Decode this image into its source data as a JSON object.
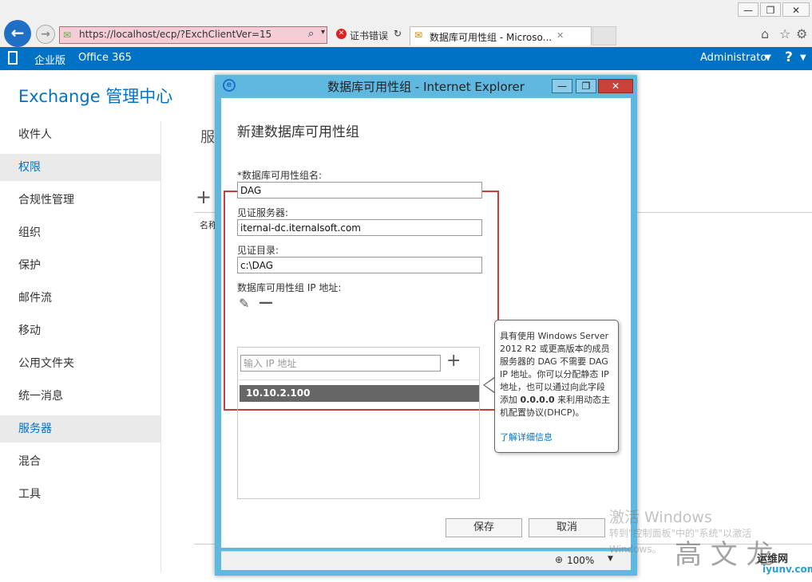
{
  "browser": {
    "window_buttons": {
      "minimize": "—",
      "restore": "❐",
      "close": "✕"
    },
    "address": "https://localhost/ecp/?ExchClientVer=15",
    "cert_error": "证书错误",
    "tab_title": "数据库可用性组 - Microso...",
    "tab_close": "✕"
  },
  "app_bar": {
    "edition": "企业版",
    "office365": "Office 365",
    "user": "Administrator",
    "help": "?"
  },
  "nav": {
    "title": "Exchange 管理中心",
    "items": [
      {
        "label": "收件人",
        "selected": false
      },
      {
        "label": "权限",
        "selected": true
      },
      {
        "label": "合规性管理",
        "selected": false
      },
      {
        "label": "组织",
        "selected": false
      },
      {
        "label": "保护",
        "selected": false
      },
      {
        "label": "邮件流",
        "selected": false
      },
      {
        "label": "移动",
        "selected": false
      },
      {
        "label": "公用文件夹",
        "selected": false
      },
      {
        "label": "统一消息",
        "selected": false
      },
      {
        "label": "服务器",
        "selected": true
      },
      {
        "label": "混合",
        "selected": false
      },
      {
        "label": "工具",
        "selected": false
      }
    ]
  },
  "background": {
    "heading": "服",
    "col_name": "名称"
  },
  "dialog": {
    "window_title": "数据库可用性组 - Internet Explorer",
    "heading": "新建数据库可用性组",
    "dag_name_label": "*数据库可用性组名:",
    "dag_name_value": "DAG",
    "witness_server_label": "见证服务器:",
    "witness_server_value": "iternal-dc.iternalsoft.com",
    "witness_dir_label": "见证目录:",
    "witness_dir_value": "c:\\DAG",
    "ip_label": "数据库可用性组 IP 地址:",
    "ip_placeholder": "输入 IP 地址",
    "ip_list": [
      "10.10.2.100"
    ],
    "save_label": "保存",
    "cancel_label": "取消",
    "zoom": "100%"
  },
  "callout": {
    "text_1": "具有使用 Windows Server 2012 R2 或更高版本的成员服务器的 DAG 不需要 DAG IP 地址。你可以分配静态 IP 地址，也可以通过向此字段添加 ",
    "text_bold": "0.0.0.0",
    "text_2": " 来利用动态主机配置协议(DHCP)。",
    "link": "了解详细信息"
  },
  "watermarks": {
    "activate_title": "激活 Windows",
    "activate_line1": "转到\"控制面板\"中的\"系统\"以激活",
    "activate_line2": "Windows。",
    "site_name": "运维网",
    "site_url": "iyunv.com",
    "logo_text": "高 文 龙"
  },
  "colors": {
    "accent": "#0072c6",
    "dialog_frame": "#5fb8e0",
    "highlight": "#cc3a3a"
  }
}
